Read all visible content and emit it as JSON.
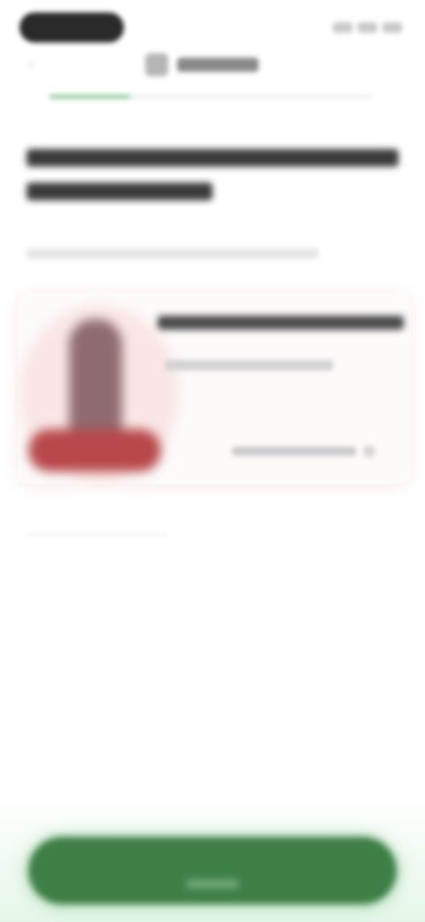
{
  "status_bar": {
    "icons": [
      "signal-icon",
      "wifi-icon",
      "battery-icon"
    ]
  },
  "header": {
    "back_icon": "back-arrow-icon",
    "brand_logo_icon": "brand-logo-icon"
  },
  "progress": {
    "value": 0.25
  },
  "card": {
    "product_image_icon": "product-photo"
  },
  "colors": {
    "primary": "#3d7f45",
    "primary_glow": "#b4e6be",
    "progress_fill": "#7fc28a",
    "product_accent": "#b8484a"
  }
}
